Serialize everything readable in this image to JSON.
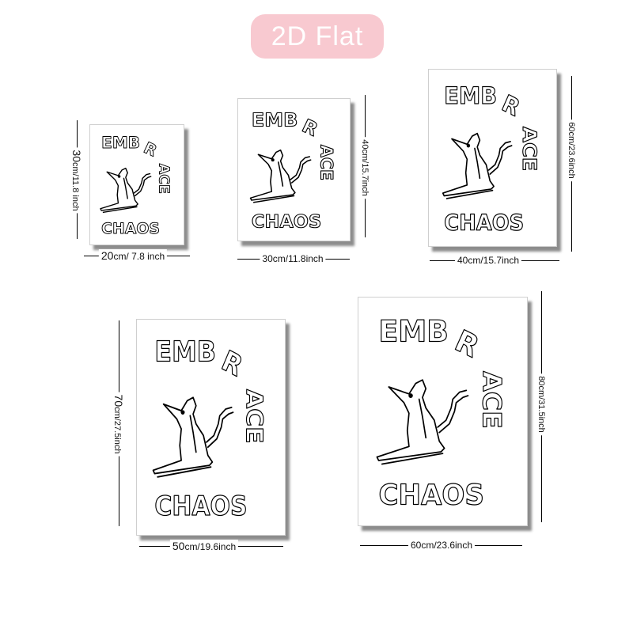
{
  "badge": {
    "label": "2D Flat",
    "bg_color": "#f8c9d0",
    "text_color": "#ffffff"
  },
  "artwork": {
    "line1": "EMB",
    "line1b": "R",
    "line2": "ACE",
    "line3": "CHAOS"
  },
  "sizes": [
    {
      "width_num": "20",
      "width_rest": "cm/ 7.8 inch",
      "height_num": "30",
      "height_rest": "cm/11.8 inch"
    },
    {
      "width_num": "30",
      "width_rest": "cm/11.8inch",
      "height_num": "40",
      "height_rest": "cm/15.7inch"
    },
    {
      "width_num": "40",
      "width_rest": "cm/15.7inch",
      "height_num": "60",
      "height_rest": "cm/23.6inch"
    },
    {
      "width_num": "50",
      "width_rest": "cm/19.6inch",
      "height_num": "70",
      "height_rest": "cm/27.5inch"
    },
    {
      "width_num": "60",
      "width_rest": "cm/23.6inch",
      "height_num": "80",
      "height_rest": "cm/31.5inch"
    }
  ]
}
